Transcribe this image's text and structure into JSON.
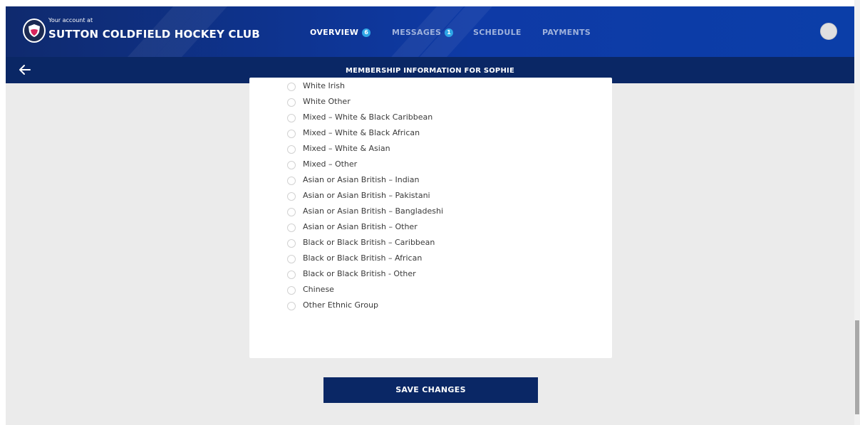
{
  "header": {
    "account_prefix": "Your account at",
    "club_name": "SUTTON COLDFIELD HOCKEY CLUB",
    "nav": [
      {
        "label": "OVERVIEW",
        "badge": "6",
        "active": true
      },
      {
        "label": "MESSAGES",
        "badge": "1",
        "active": false
      },
      {
        "label": "SCHEDULE",
        "badge": "",
        "active": false
      },
      {
        "label": "PAYMENTS",
        "badge": "",
        "active": false
      }
    ]
  },
  "subheader": {
    "title": "MEMBERSHIP INFORMATION FOR SOPHIE"
  },
  "ethnicity_options": [
    "White Irish",
    "White Other",
    "Mixed – White & Black Caribbean",
    "Mixed – White & Black African",
    "Mixed – White & Asian",
    "Mixed – Other",
    "Asian or Asian British – Indian",
    "Asian or Asian British – Pakistani",
    "Asian or Asian British – Bangladeshi",
    "Asian or Asian British – Other",
    "Black or Black British – Caribbean",
    "Black or Black British – African",
    "Black or Black British - Other",
    "Chinese",
    "Other Ethnic Group"
  ],
  "actions": {
    "save_label": "SAVE CHANGES"
  },
  "colors": {
    "header_blue": "#0e3aa6",
    "navy": "#0a2765",
    "badge": "#2ea6e6",
    "background": "#ebebeb"
  }
}
